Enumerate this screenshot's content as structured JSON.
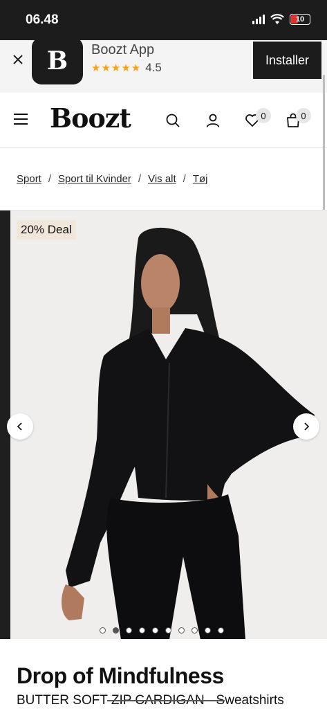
{
  "status_bar": {
    "time": "06.48",
    "battery": "10"
  },
  "app_banner": {
    "logo_letter": "B",
    "app_name": "Boozt App",
    "stars": "★★★★★",
    "rating": "4.5",
    "install_label": "Installer"
  },
  "header": {
    "logo": "Boozt",
    "wishlist_count": "0",
    "cart_count": "0"
  },
  "breadcrumb": {
    "items": [
      "Sport",
      "Sport til Kvinder",
      "Vis alt",
      "Tøj"
    ],
    "separator": "/"
  },
  "gallery": {
    "deal_label": "20% Deal",
    "image_count": 10,
    "active_index": 1
  },
  "product": {
    "brand": "Drop of Mindfulness",
    "title": "BUTTER SOFT ZIP CARDIGAN - Sweatshirts"
  },
  "colors": {
    "dark": "#1c1c1c",
    "star": "#f2a51a",
    "deal_bg": "#f0e6da"
  }
}
